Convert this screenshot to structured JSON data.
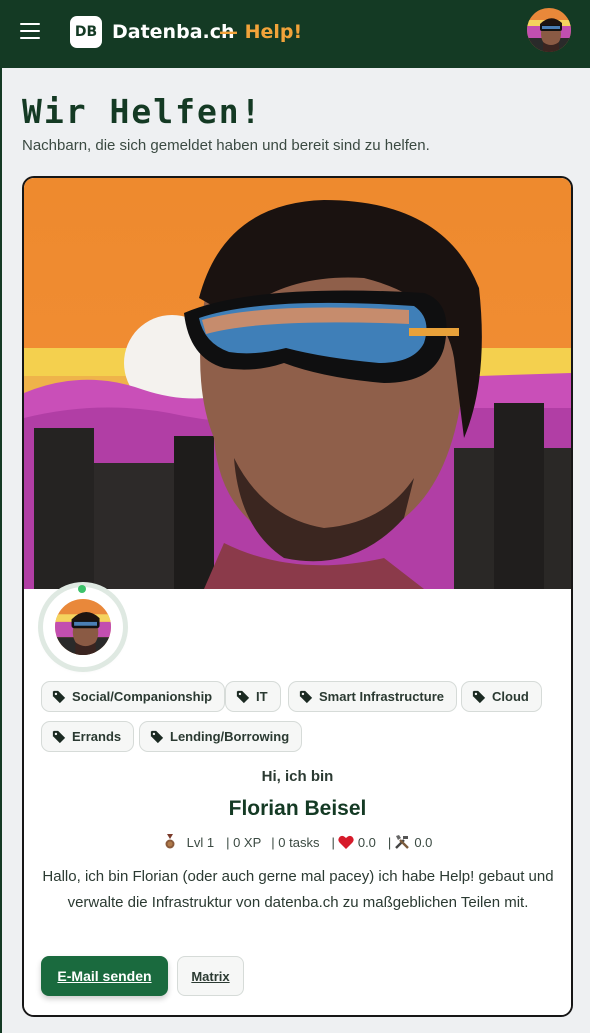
{
  "header": {
    "logo_text": "DB",
    "brand_name": "Datenba.ch",
    "brand_suffix": "— Help!",
    "menu_icon": "hamburger-menu-icon",
    "avatar_icon": "user-avatar"
  },
  "page": {
    "title": "Wir Helfen!",
    "subtitle": "Nachbarn, die sich gemeldet haben und bereit sind zu helfen."
  },
  "profile": {
    "status": "online",
    "tags": [
      {
        "label": "Social/Companionship"
      },
      {
        "label": "IT"
      },
      {
        "label": "Smart Infrastructure"
      },
      {
        "label": "Cloud"
      },
      {
        "label": "Errands"
      },
      {
        "label": "Lending/Borrowing"
      }
    ],
    "greeting": "Hi, ich bin",
    "name": "Florian Beisel",
    "stats": {
      "level": "Lvl 1",
      "xp": "| 0 XP",
      "tasks": "| 0 tasks",
      "hearts_sep": "|",
      "hearts": "0.0",
      "tools_sep": "|",
      "tools": "0.0"
    },
    "bio": "Hallo, ich bin Florian (oder auch gerne mal pacey) ich habe Help! gebaut und verwalte die Infrastruktur von datenba.ch zu maßgeblichen Teilen mit.",
    "email_button": "E-Mail senden",
    "matrix_button": "Matrix"
  },
  "colors": {
    "header_bg": "#143a24",
    "accent": "#f2a33a",
    "primary_button": "#1a6a3e"
  }
}
